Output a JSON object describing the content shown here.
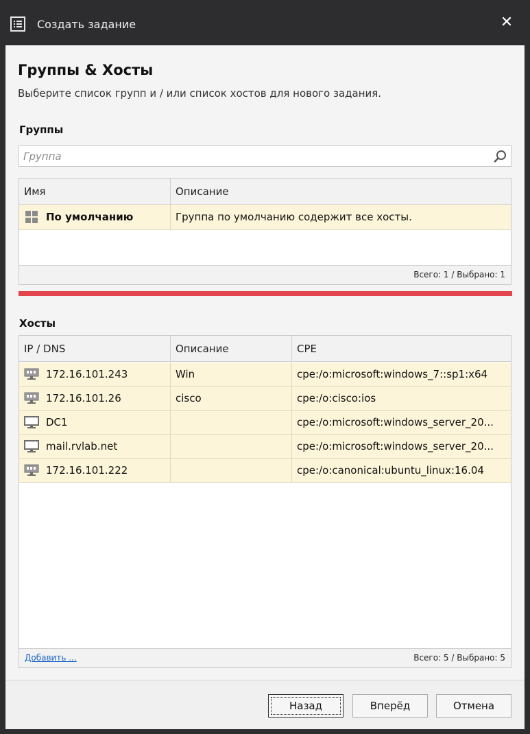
{
  "window": {
    "title": "Создать задание",
    "close_glyph": "✕"
  },
  "header": {
    "title": "Группы & Хосты",
    "subtitle": "Выберите список групп и / или список хостов для нового задания."
  },
  "groups": {
    "label": "Группы",
    "search_placeholder": "Группа",
    "columns": [
      "Имя",
      "Описание"
    ],
    "rows": [
      {
        "name": "По умолчанию",
        "description": "Группа по умолчанию содержит все хосты.",
        "icon": "group-grid-icon"
      }
    ],
    "stats": "Всего: 1  / Выбрано: 1"
  },
  "hosts": {
    "label": "Хосты",
    "columns": [
      "IP / DNS",
      "Описание",
      "CPE"
    ],
    "rows": [
      {
        "address": "172.16.101.243",
        "description": "Win",
        "cpe": "cpe:/o:microsoft:windows_7::sp1:x64",
        "icon": "network-host-icon"
      },
      {
        "address": "172.16.101.26",
        "description": "cisco",
        "cpe": "cpe:/o:cisco:ios",
        "icon": "network-host-icon"
      },
      {
        "address": "DC1",
        "description": "",
        "cpe": "cpe:/o:microsoft:windows_server_20...",
        "icon": "monitor-icon"
      },
      {
        "address": "mail.rvlab.net",
        "description": "",
        "cpe": "cpe:/o:microsoft:windows_server_20...",
        "icon": "monitor-icon"
      },
      {
        "address": "172.16.101.222",
        "description": "",
        "cpe": "cpe:/o:canonical:ubuntu_linux:16.04",
        "icon": "network-host-icon"
      }
    ],
    "add_link": "Добавить ...",
    "stats": "Всего: 5  / Выбрано: 5"
  },
  "buttons": {
    "back": "Назад",
    "next": "Вперёд",
    "cancel": "Отмена"
  },
  "colors": {
    "title_bar": "#2d2d30",
    "row_highlight": "#fdf5d9",
    "separator_red": "#e3454f",
    "link": "#1a63c9"
  }
}
